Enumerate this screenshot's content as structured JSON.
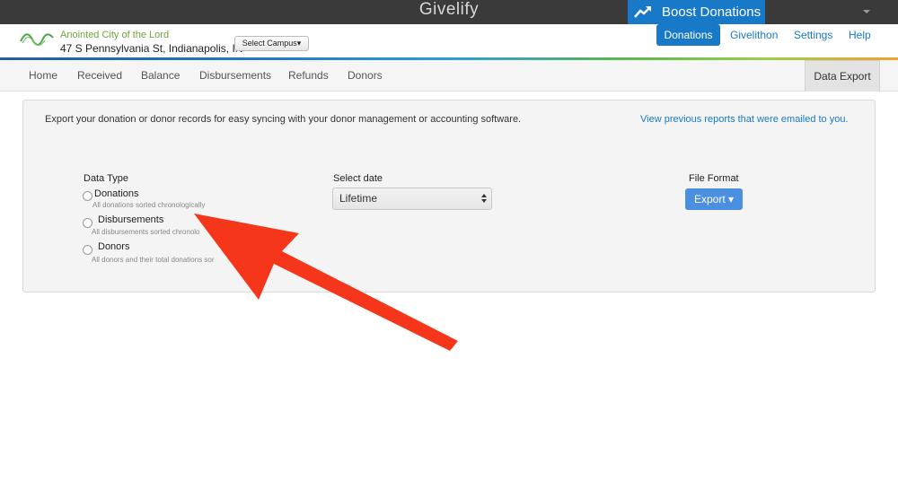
{
  "topbar": {
    "brand": "Givelify",
    "boost_label": "Boost Donations"
  },
  "header": {
    "church_name": "Anointed City of the Lord",
    "church_address": "47 S Pennsylvania St, Indianapolis, IN",
    "campus_button": "Select Campus▾",
    "nav": {
      "donations": "Donations",
      "givelithon": "Givelithon",
      "settings": "Settings",
      "help": "Help"
    }
  },
  "tabs": {
    "home": "Home",
    "received": "Received",
    "balance": "Balance",
    "disbursements": "Disbursements",
    "refunds": "Refunds",
    "donors": "Donors",
    "data_export": "Data Export"
  },
  "export": {
    "intro": "Export your donation or donor records for easy syncing with your donor management or accounting software.",
    "previous_link": "View previous reports that were emailed to you.",
    "data_type_label": "Data Type",
    "options": [
      {
        "label": "Donations",
        "desc": "All donations sorted chronologically"
      },
      {
        "label": "Disbursements",
        "desc": "All disbursements sorted chronolo"
      },
      {
        "label": "Donors",
        "desc": "All donors and their total donations sor"
      }
    ],
    "date_label": "Select date",
    "date_value": "Lifetime",
    "format_label": "File Format",
    "export_button": "Export ▾"
  },
  "colors": {
    "accent_blue": "#1779c8",
    "button_blue": "#4b8fe0",
    "annotation_red": "#f6361b",
    "church_green": "#6ea63a"
  }
}
